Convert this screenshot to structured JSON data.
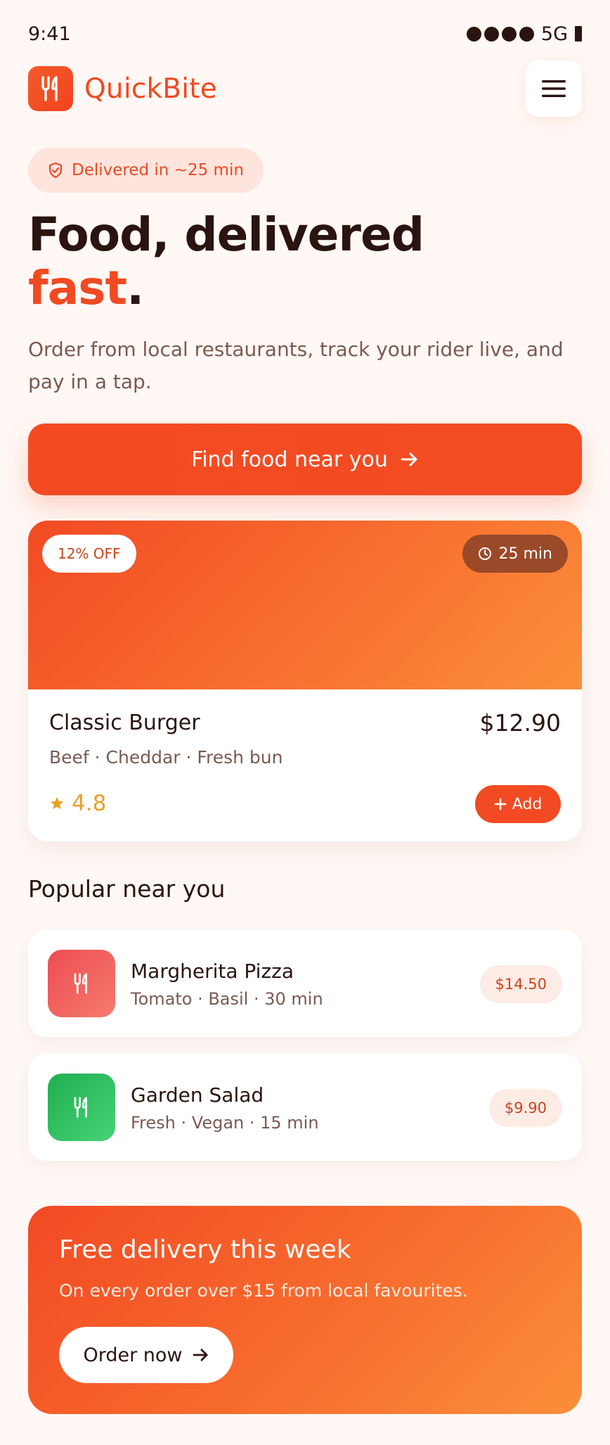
{
  "status_bar": {
    "time": "9:41",
    "network": "5G"
  },
  "header": {
    "brand": "QuickBite",
    "logo_icon": "utensils-icon",
    "menu_icon": "hamburger-menu-icon"
  },
  "hero": {
    "pill": "Delivered in ~25 min",
    "title_line1": "Food, delivered",
    "title_accent": "fast",
    "title_period": ".",
    "lead": "Order from local restaurants, track your rider live, and pay in a tap.",
    "cta": "Find food near you"
  },
  "featured": {
    "discount": "12% OFF",
    "time": "25 min",
    "name": "Classic Burger",
    "price": "$12.90",
    "description": "Beef · Cheddar · Fresh bun",
    "rating": "4.8",
    "add_label": "Add"
  },
  "popular": {
    "title": "Popular near you",
    "items": [
      {
        "name": "Margherita Pizza",
        "meta": "Tomato · Basil · 30 min",
        "price": "$14.50",
        "color": "#ef5a5a"
      },
      {
        "name": "Garden Salad",
        "meta": "Fresh · Vegan · 15 min",
        "price": "$9.90",
        "color": "#2fbf5a"
      }
    ]
  },
  "promo": {
    "title": "Free delivery this week",
    "subtitle": "On every order over $15 from local favourites.",
    "button": "Order now"
  },
  "colors": {
    "brand": "#f04a22",
    "text": "#2a1410",
    "muted": "#7a5a52",
    "star": "#eaa02a"
  }
}
